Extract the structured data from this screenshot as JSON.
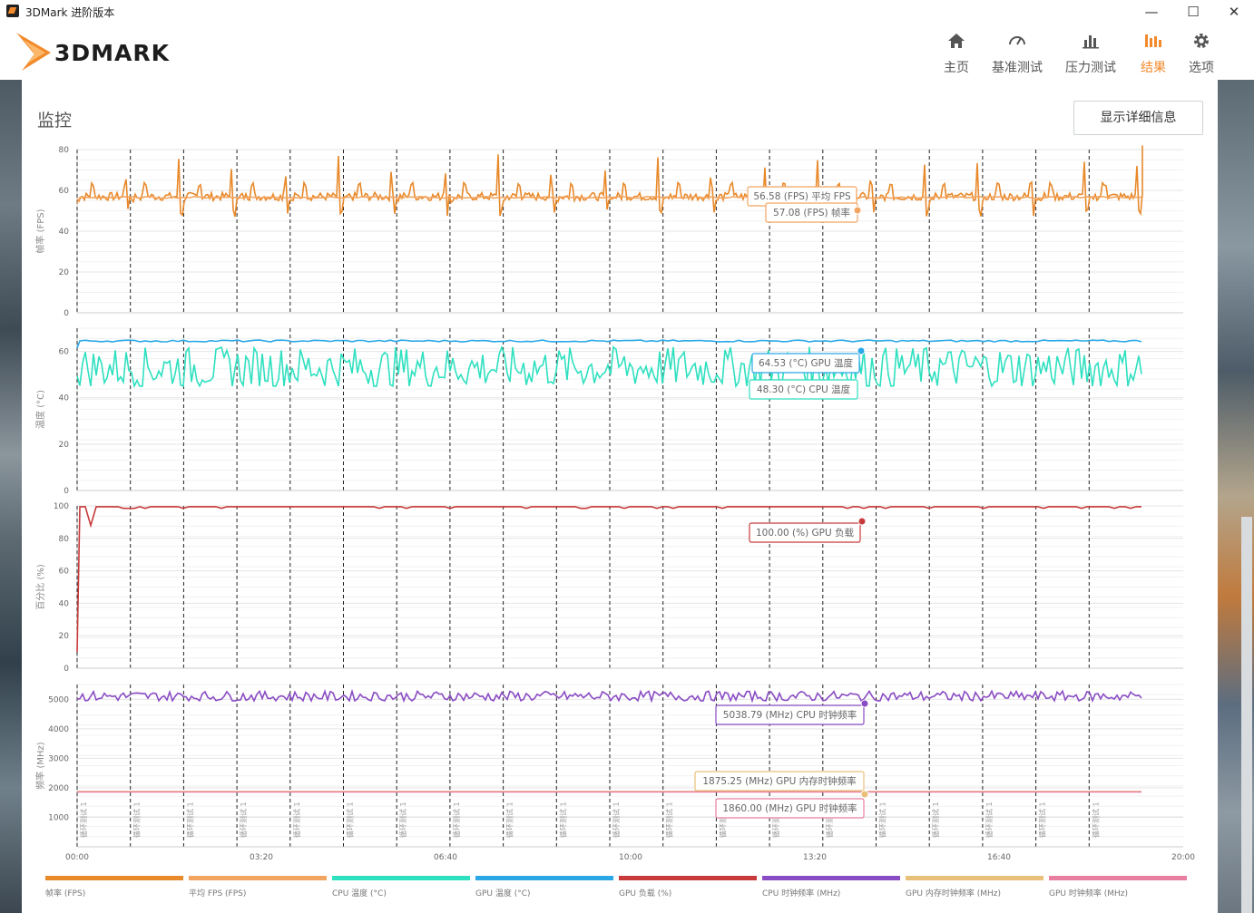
{
  "window": {
    "title": "3DMark 进阶版本",
    "controls": [
      "—",
      "☐",
      "✕"
    ]
  },
  "nav": [
    {
      "label": "主页",
      "icon": "home-icon",
      "active": false
    },
    {
      "label": "基准测试",
      "icon": "gauge-icon",
      "active": false
    },
    {
      "label": "压力测试",
      "icon": "stress-chart-icon",
      "active": false
    },
    {
      "label": "结果",
      "icon": "results-chart-icon",
      "active": true
    },
    {
      "label": "选项",
      "icon": "gear-icon",
      "active": false
    }
  ],
  "logo_text": "3DMARK",
  "section_title": "监控",
  "details_button": "显示详细信息",
  "colors": {
    "accent": "#f28a2b",
    "fps": "#e8892a",
    "avg_fps": "#f2a561",
    "cpu_temp": "#2fe0c0",
    "gpu_temp": "#2aa8e6",
    "gpu_load": "#c83a3a",
    "cpu_clock": "#8a4cc4",
    "gpu_mem_clock": "#e8c07a",
    "gpu_clock": "#e87ea0"
  },
  "chart_data": {
    "type": "line",
    "x_axis": {
      "ticks": [
        "00:00",
        "03:20",
        "06:40",
        "10:00",
        "13:20",
        "16:40",
        "20:00"
      ],
      "range": [
        "00:00",
        "20:00"
      ]
    },
    "loop_marker_label": "循环测试 1",
    "loop_count": 20,
    "panels": [
      {
        "ylabel": "帧率 (FPS)",
        "ylim": [
          0,
          80
        ],
        "yticks": [
          0,
          20,
          40,
          60,
          80
        ],
        "series": [
          {
            "name": "帧率 (FPS)",
            "color_key": "fps",
            "pattern": "periodic-spikes",
            "min": 47,
            "max": 82,
            "typical": 57
          },
          {
            "name": "平均 FPS (FPS)",
            "color_key": "avg_fps",
            "value": 56.58
          }
        ],
        "tooltips": [
          "56.58 (FPS) 平均 FPS",
          "57.08 (FPS) 帧率"
        ]
      },
      {
        "ylabel": "温度 (°C)",
        "ylim": [
          0,
          70
        ],
        "yticks": [
          0,
          20,
          40,
          60
        ],
        "series": [
          {
            "name": "GPU 温度 (°C)",
            "color_key": "gpu_temp",
            "value": 64.5
          },
          {
            "name": "CPU 温度 (°C)",
            "color_key": "cpu_temp",
            "min": 45,
            "max": 63,
            "typical": 53
          }
        ],
        "tooltips": [
          "64.53 (°C) GPU 温度",
          "48.30 (°C) CPU 温度"
        ]
      },
      {
        "ylabel": "百分比 (%)",
        "ylim": [
          0,
          100
        ],
        "yticks": [
          0,
          20,
          40,
          60,
          80,
          100
        ],
        "series": [
          {
            "name": "GPU 负载 (%)",
            "color_key": "gpu_load",
            "value": 99.5
          }
        ],
        "tooltips": [
          "100.00 (%) GPU 负载"
        ]
      },
      {
        "ylabel": "频率 (MHz)",
        "ylim": [
          0,
          5500
        ],
        "yticks": [
          1000,
          2000,
          3000,
          4000,
          5000
        ],
        "series": [
          {
            "name": "CPU 时钟频率 (MHz)",
            "color_key": "cpu_clock",
            "min": 4950,
            "max": 5300,
            "typical": 5100
          },
          {
            "name": "GPU 内存时钟频率 (MHz)",
            "color_key": "gpu_mem_clock",
            "value": 1875.25
          },
          {
            "name": "GPU 时钟频率 (MHz)",
            "color_key": "gpu_clock",
            "value": 1860
          }
        ],
        "tooltips": [
          "5038.79 (MHz) CPU 时钟频率",
          "1875.25 (MHz) GPU 内存时钟频率",
          "1860.00 (MHz) GPU 时钟频率"
        ]
      }
    ],
    "legend": [
      {
        "name": "帧率 (FPS)",
        "color_key": "fps"
      },
      {
        "name": "平均 FPS (FPS)",
        "color_key": "avg_fps"
      },
      {
        "name": "CPU 温度 (°C)",
        "color_key": "cpu_temp"
      },
      {
        "name": "GPU 温度 (°C)",
        "color_key": "gpu_temp"
      },
      {
        "name": "GPU 负载 (%)",
        "color_key": "gpu_load"
      },
      {
        "name": "CPU 时钟频率 (MHz)",
        "color_key": "cpu_clock"
      },
      {
        "name": "GPU 内存时钟频率 (MHz)",
        "color_key": "gpu_mem_clock"
      },
      {
        "name": "GPU 时钟频率 (MHz)",
        "color_key": "gpu_clock"
      }
    ]
  }
}
